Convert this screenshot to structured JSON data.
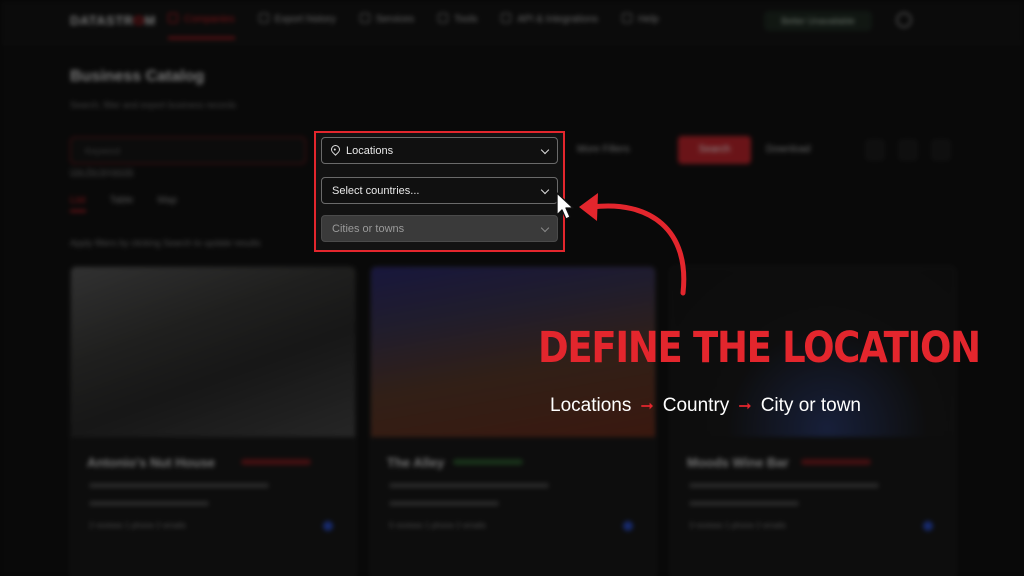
{
  "topbar": {
    "logo_prefix": "DATASTR",
    "logo_mark": "O",
    "logo_suffix": "M",
    "nav": [
      {
        "label": "Companies",
        "active": true
      },
      {
        "label": "Export history",
        "active": false
      },
      {
        "label": "Services",
        "active": false
      },
      {
        "label": "Tools",
        "active": false
      },
      {
        "label": "API & Integrations",
        "active": false
      },
      {
        "label": "Help",
        "active": false
      }
    ],
    "upgrade_label": "Better Unavailable"
  },
  "page": {
    "title": "Business Catalog",
    "subtitle": "Search, filter and export business records",
    "keyword_placeholder": "Keyword",
    "use_keywords_link": "Use the keywords",
    "more_filters_label": "More Filters",
    "search_label": "Search",
    "download_label": "Download",
    "view_tabs": [
      "List",
      "Table",
      "Map"
    ],
    "hint": "Apply filters by clicking Search to update results"
  },
  "location_panel": {
    "locations_label": "Locations",
    "countries_placeholder": "Select countries...",
    "cities_placeholder": "Cities or towns"
  },
  "cards": [
    {
      "name": "Antonio's Nut House",
      "meta": "2 reviews  1 phone  2 emails"
    },
    {
      "name": "The Alley",
      "meta": "5 reviews  1 phone  2 emails"
    },
    {
      "name": "Moods Wine Bar",
      "meta": "3 reviews  1 phone  2 emails"
    }
  ],
  "annotation": {
    "headline": "DEFINE THE LOCATION",
    "step1": "Locations",
    "step2": "Country",
    "step3": "City or town",
    "arrow_glyph": "➞"
  },
  "colors": {
    "accent": "#e3262d",
    "background": "#0b0b0b"
  }
}
